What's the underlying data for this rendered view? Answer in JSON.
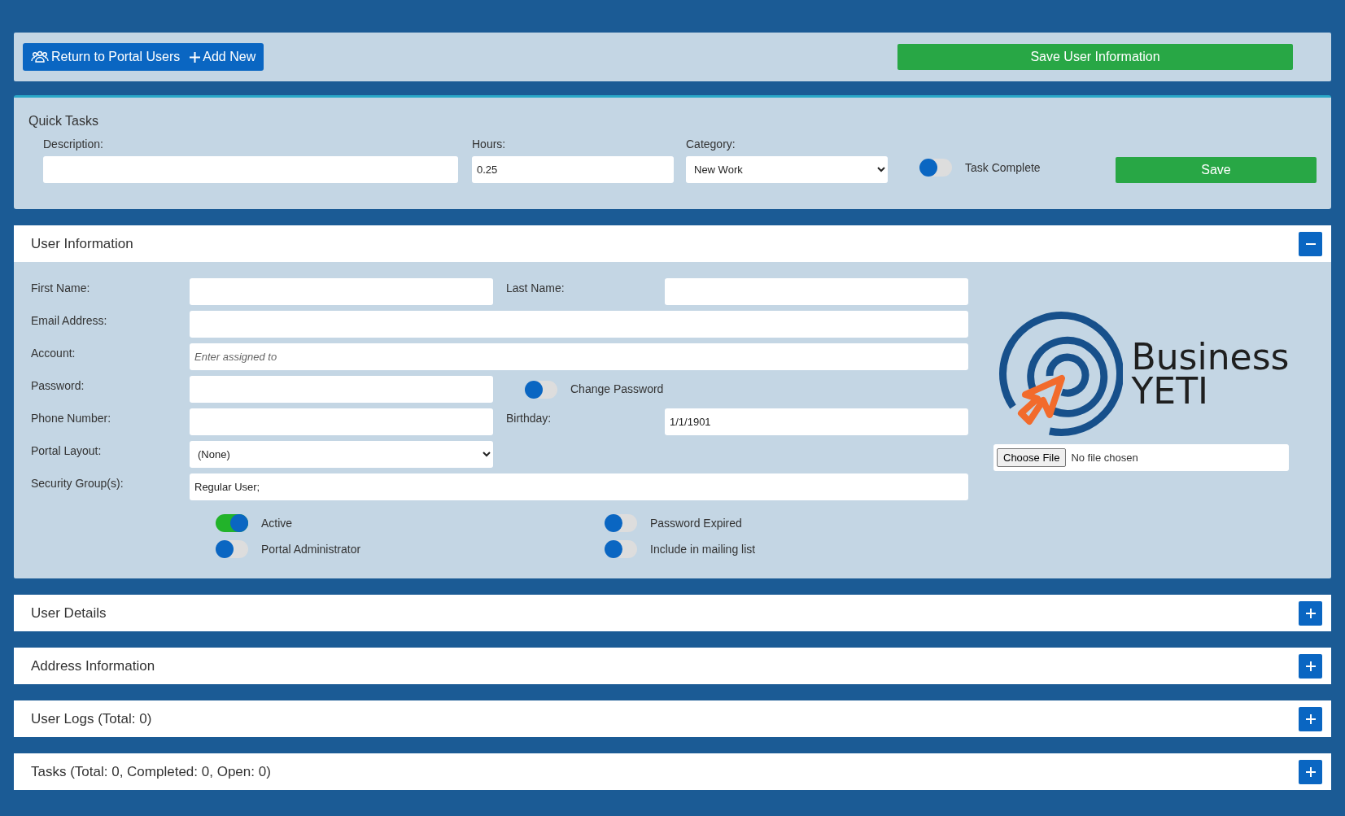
{
  "toolbar": {
    "buttons": [
      {
        "label": "Return to Portal Users"
      },
      {
        "label": "Add New"
      }
    ],
    "save_button": "Save User Information"
  },
  "quick_tasks": {
    "title": "Quick Tasks",
    "description": {
      "label": "Description:"
    },
    "hours": {
      "label": "Hours:",
      "value": "0.25"
    },
    "category": {
      "label": "Category:",
      "value": "New Work"
    },
    "task_complete": {
      "label": "Task Complete",
      "on": false
    },
    "save_button": "Save"
  },
  "user_information": {
    "title": "User Information",
    "expanded": true,
    "rows": [
      [
        {
          "kind": "text",
          "label": "First Name:",
          "wide": false
        },
        {
          "kind": "text",
          "label": "Last Name:",
          "wide": false
        }
      ],
      [
        {
          "kind": "text",
          "label": "Email Address:",
          "wide": true
        }
      ],
      [
        {
          "kind": "text",
          "label": "Account:",
          "placeholder": "Enter assigned to",
          "wide": true
        }
      ],
      [
        {
          "kind": "text",
          "label": "Password:",
          "wide": false
        },
        {
          "kind": "toggle",
          "label": "Change Password",
          "on": false
        }
      ],
      [
        {
          "kind": "text",
          "label": "Phone Number:",
          "wide": false
        },
        {
          "kind": "text",
          "label": "Birthday:",
          "value": "1/1/1901",
          "wide": false
        }
      ],
      [
        {
          "kind": "select",
          "label": "Portal Layout:",
          "value": "(None)",
          "wide": false
        }
      ],
      [
        {
          "kind": "text",
          "label": "Security Group(s):",
          "value": "Regular User;",
          "wide": true
        }
      ]
    ],
    "toggles": [
      {
        "label": "Active",
        "on": true
      },
      {
        "label": "Password Expired",
        "on": false
      },
      {
        "label": "Portal Administrator",
        "on": false
      },
      {
        "label": "Include in mailing list",
        "on": false
      }
    ],
    "logo_text": [
      "Business",
      "YETI"
    ],
    "file_input": {
      "button": "Choose File",
      "status": "No file chosen"
    }
  },
  "sections": [
    {
      "title": "User Details",
      "expanded": false
    },
    {
      "title": "Address Information",
      "expanded": false
    },
    {
      "title": "User Logs (Total: 0)",
      "expanded": false
    },
    {
      "title": "Tasks (Total: 0, Completed: 0, Open: 0)",
      "expanded": false
    }
  ]
}
